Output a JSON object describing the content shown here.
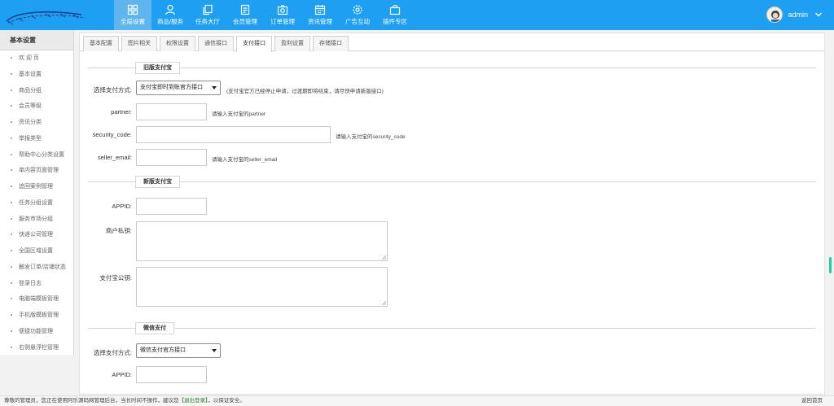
{
  "nav": [
    {
      "label": "全局设置",
      "icon": "grid-icon",
      "active": true
    },
    {
      "label": "商品/服务",
      "icon": "user-icon"
    },
    {
      "label": "任务大厅",
      "icon": "copy-icon"
    },
    {
      "label": "会员管理",
      "icon": "document-icon"
    },
    {
      "label": "订单管理",
      "icon": "camera-icon"
    },
    {
      "label": "资讯管理",
      "icon": "calendar-icon"
    },
    {
      "label": "广告互动",
      "icon": "gear-icon"
    },
    {
      "label": "插件专区",
      "icon": "bag-icon"
    }
  ],
  "user": {
    "name": "admin"
  },
  "sidebar": {
    "title": "基本设置",
    "items": [
      "欢 迎 页",
      "基本设置",
      "商品分组",
      "会员等级",
      "资讯分类",
      "举报类型",
      "帮助中心分类设置",
      "单内容页面管理",
      "追回案例管理",
      "任务分组设置",
      "服务市场分组",
      "快递公司管理",
      "全国区域设置",
      "触发订单/店铺状态",
      "登录日志",
      "电脑端模板管理",
      "手机版模板管理",
      "便捷功能管理",
      "右侧悬浮栏管理"
    ]
  },
  "tabs": [
    "基本配置",
    "图片相关",
    "权限设置",
    "通信接口",
    "支付接口",
    "盈利设置",
    "存储接口"
  ],
  "active_tab": 4,
  "form": {
    "old_alipay": {
      "title": "旧版支付宝",
      "method_label": "选择支付方式:",
      "method_value": "支付宝即时到账官方接口",
      "method_hint": "(支付宝官方已经停止申请，过渡期即将结束，请尽快申请新版接口)",
      "partner_label": "partner:",
      "partner_hint": "请输入支付宝的partner",
      "security_label": "security_code:",
      "security_hint": "请输入支付宝的security_code",
      "seller_label": "seller_email:",
      "seller_hint": "请输入支付宝的seller_email"
    },
    "new_alipay": {
      "title": "新版支付宝",
      "appid_label": "APPID:",
      "private_key_label": "商户私钥:",
      "public_key_label": "支付宝公钥:"
    },
    "wechat": {
      "title": "微信支付",
      "method_label": "选择支付方式:",
      "method_value": "微信支付官方接口",
      "appid_label": "APPID:"
    }
  },
  "footer": {
    "prefix": "尊敬的管理员，您正在使用阿乐源码网管理后台，当长时间不操作，建议您",
    "logout": "【退出登录】",
    "suffix": "，以保证安全。",
    "right": "返回首页"
  }
}
